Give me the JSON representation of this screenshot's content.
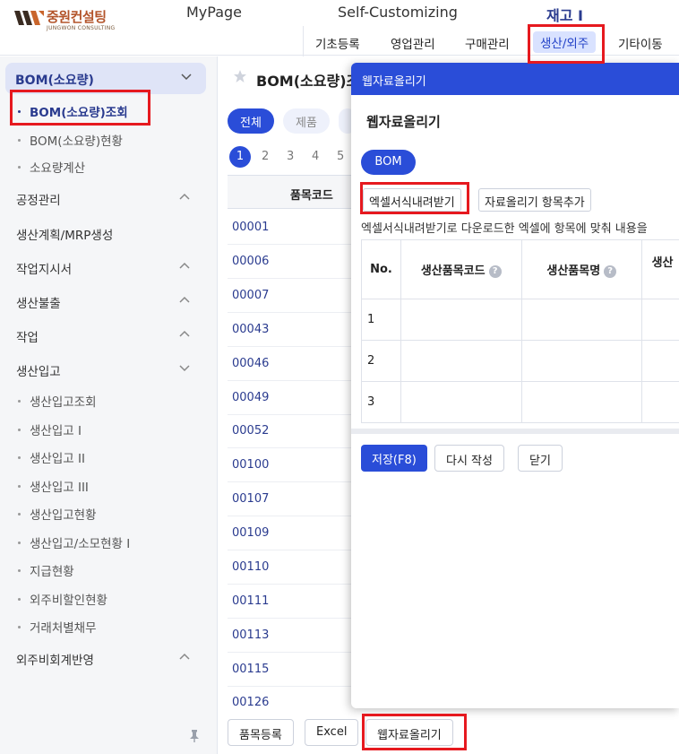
{
  "header": {
    "logo_name": "중원컨설팅",
    "logo_sub": "JUNGWON CONSULTING",
    "nav": [
      "MyPage",
      "Self-Customizing",
      "재고 I"
    ],
    "subnav": [
      "기초등록",
      "영업관리",
      "구매관리",
      "생산/외주",
      "기타이동"
    ]
  },
  "sidebar": {
    "head": "BOM(소요량)",
    "subs_top": [
      "BOM(소요량)조회",
      "BOM(소요량)현황",
      "소요량계산"
    ],
    "groups": [
      "공정관리",
      "생산계획/MRP생성",
      "작업지시서",
      "생산불출",
      "작업",
      "생산입고"
    ],
    "subs_prod": [
      "생산입고조회",
      "생산입고 I",
      "생산입고 II",
      "생산입고 III",
      "생산입고현황",
      "생산입고/소모현황 I",
      "지급현황",
      "외주비할인현황",
      "거래처별채무"
    ],
    "last_group": "외주비회계반영"
  },
  "main": {
    "title": "BOM(소요량)조",
    "chip_all": "전체",
    "chip_product": "제품",
    "pages": [
      "1",
      "2",
      "3",
      "4",
      "5"
    ],
    "col_header": "품목코드",
    "codes": [
      "00001",
      "00006",
      "00007",
      "00043",
      "00046",
      "00049",
      "00052",
      "00100",
      "00107",
      "00109",
      "00110",
      "00111",
      "00113",
      "00115",
      "00126"
    ]
  },
  "bottom": {
    "btn_register": "품목등록",
    "btn_excel": "Excel",
    "btn_upload": "웹자료올리기"
  },
  "modal": {
    "header": "웹자료올리기",
    "title": "웹자료올리기",
    "tab": "BOM",
    "btn_download": "엑셀서식내려받기",
    "btn_add_item": "자료올리기 항목추가",
    "instruction": "엑셀서식내려받기로 다운로드한 엑셀에 항목에 맞춰 내용을",
    "columns": [
      "No.",
      "생산품목코드",
      "생산품목명",
      "생산"
    ],
    "rows": [
      "1",
      "2",
      "3"
    ],
    "btn_save": "저장(F8)",
    "btn_rewrite": "다시 작성",
    "btn_close": "닫기"
  }
}
